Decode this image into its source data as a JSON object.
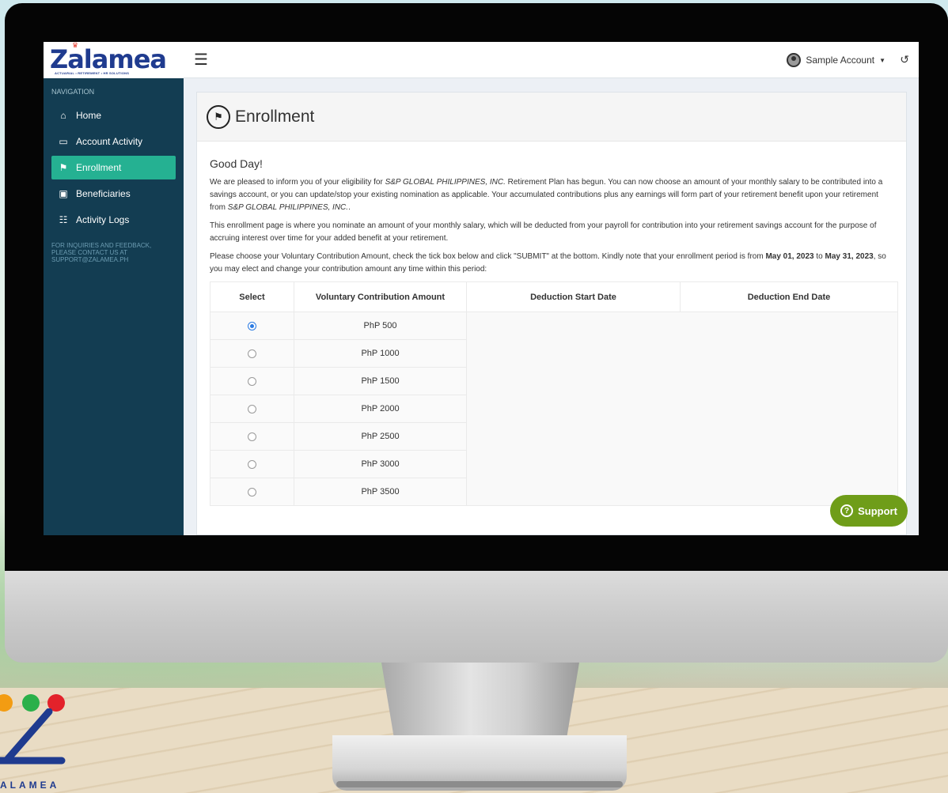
{
  "app": {
    "logo_text": "Zalamea",
    "logo_tagline": "ACTUARIAL • RETIREMENT • HR SOLUTIONS",
    "account_name": "Sample Account"
  },
  "sidebar": {
    "heading": "NAVIGATION",
    "items": [
      {
        "label": "Home",
        "icon": "home-icon"
      },
      {
        "label": "Account Activity",
        "icon": "folder-icon"
      },
      {
        "label": "Enrollment",
        "icon": "flag-icon",
        "active": true
      },
      {
        "label": "Beneficiaries",
        "icon": "gift-icon"
      },
      {
        "label": "Activity Logs",
        "icon": "list-icon"
      }
    ],
    "note": "FOR INQUIRIES AND FEEDBACK, PLEASE CONTACT US AT SUPPORT@ZALAMEA.PH"
  },
  "page": {
    "title": "Enrollment",
    "greeting": "Good Day!",
    "para1_a": "We are pleased to inform you of your eligibility for ",
    "company": "S&P GLOBAL PHILIPPINES, INC.",
    "para1_b": " Retirement Plan has begun. You can now choose an amount of your monthly salary to be contributed into a savings account, or you can update/stop your existing nomination as applicable. Your accumulated contributions plus any earnings will form part of your retirement benefit upon your retirement from ",
    "company2": "S&P GLOBAL PHILIPPINES, INC.",
    "para1_c": ".",
    "para2": "This enrollment page is where you nominate an amount of your monthly salary, which will be deducted from your payroll for contribution into your retirement savings account for the purpose of accruing interest over time for your added benefit at your retirement.",
    "para3_a": "Please choose your Voluntary Contribution Amount, check the tick box below and click \"SUBMIT\" at the bottom. Kindly note that your enrollment period is from ",
    "period_start": "May 01, 2023",
    "para3_to": " to ",
    "period_end": "May 31, 2023",
    "para3_b": ", so you may elect and change your contribution amount any time within this period:"
  },
  "table": {
    "headers": [
      "Select",
      "Voluntary Contribution Amount",
      "Deduction Start Date",
      "Deduction End Date"
    ],
    "rows": [
      {
        "amount": "PhP 500",
        "selected": true
      },
      {
        "amount": "PhP 1000",
        "selected": false
      },
      {
        "amount": "PhP 1500",
        "selected": false
      },
      {
        "amount": "PhP 2000",
        "selected": false
      },
      {
        "amount": "PhP 2500",
        "selected": false
      },
      {
        "amount": "PhP 3000",
        "selected": false
      },
      {
        "amount": "PhP 3500",
        "selected": false
      }
    ]
  },
  "support_label": "Support",
  "brand": {
    "text": "ALAMEA"
  },
  "colors": {
    "sidebar": "#133d52",
    "active": "#25b192",
    "support": "#6f9d19",
    "logo": "#1f3b8f"
  }
}
